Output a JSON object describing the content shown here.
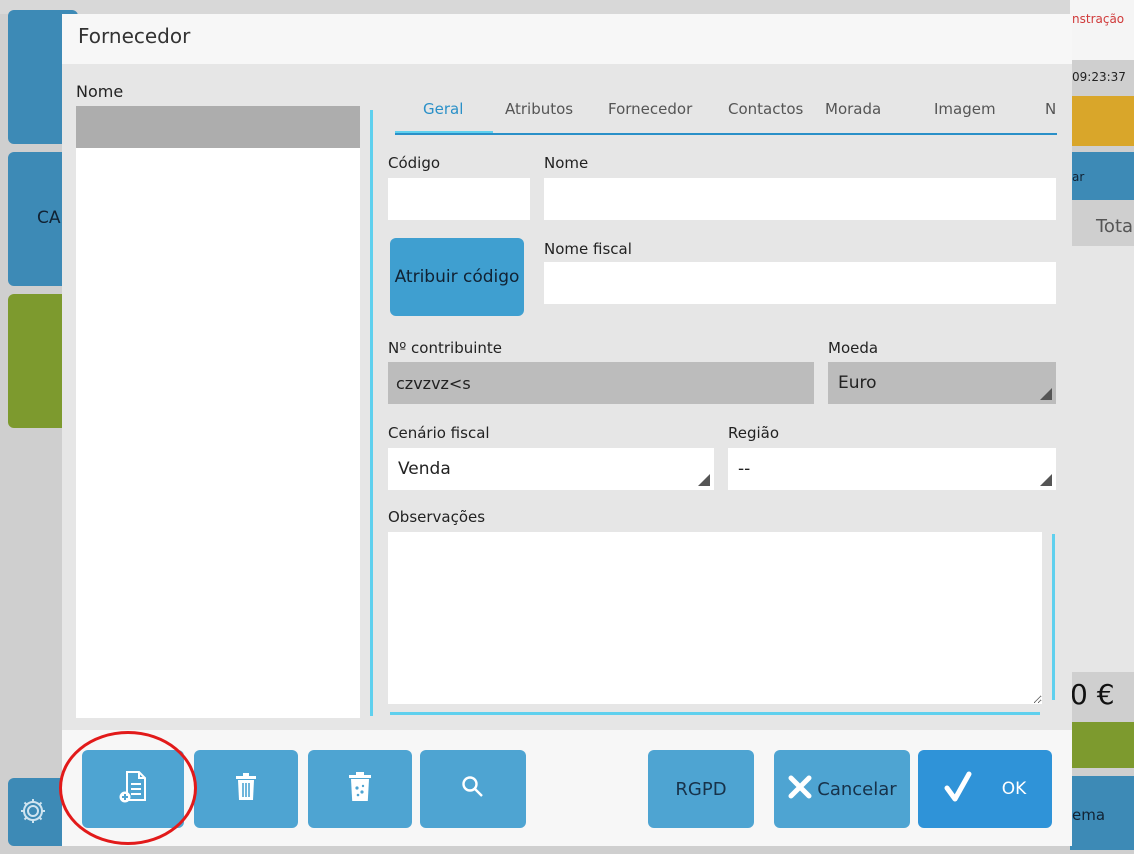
{
  "background": {
    "header_right_text": "nstração",
    "clock": "09:23:37",
    "button_partial": "ar",
    "column_total": "Total",
    "tile_partial": "CA",
    "total_amount": "0 €",
    "footer_partial": "ema",
    "colors": {
      "tile_blue": "#3d8ab6",
      "tile_olive": "#7d9a2e",
      "tile_gold": "#d9a62a",
      "header_red": "#d03a3a"
    }
  },
  "dialog": {
    "title": "Fornecedor",
    "list": {
      "column_header": "Nome",
      "selected_index": 0
    },
    "tabs": [
      {
        "label": "Geral",
        "active": true
      },
      {
        "label": "Atributos",
        "active": false
      },
      {
        "label": "Fornecedor",
        "active": false
      },
      {
        "label": "Contactos",
        "active": false
      },
      {
        "label": "Morada",
        "active": false
      },
      {
        "label": "Imagem",
        "active": false
      },
      {
        "label": "N",
        "active": false
      }
    ],
    "form": {
      "codigo_label": "Código",
      "codigo_value": "",
      "nome_label": "Nome",
      "nome_value": "",
      "assign_code_button": "Atribuir código",
      "nome_fiscal_label": "Nome fiscal",
      "nome_fiscal_value": "",
      "contribuinte_label": "Nº contribuinte",
      "contribuinte_value": "czvzvz<s",
      "moeda_label": "Moeda",
      "moeda_value": "Euro",
      "cenario_label": "Cenário fiscal",
      "cenario_value": "Venda",
      "regiao_label": "Região",
      "regiao_value": "--",
      "observacoes_label": "Observações",
      "observacoes_value": ""
    },
    "footer": {
      "new_icon": "new-document-icon",
      "delete_icon": "trash-icon",
      "delete_all_icon": "trash-full-icon",
      "search_icon": "search-icon",
      "rgpd_label": "RGPD",
      "cancel_label": "Cancelar",
      "ok_label": "OK"
    },
    "accent_color": "#5fd0ee",
    "highlight_color": "#e21a1a"
  }
}
